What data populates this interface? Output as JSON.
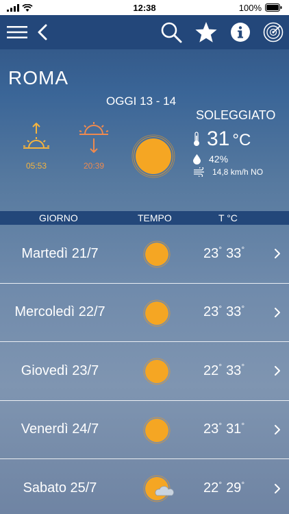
{
  "status_bar": {
    "time": "12:38",
    "battery": "100%"
  },
  "nav": {
    "menu_icon": "hamburger-icon",
    "back_icon": "chevron-left-icon",
    "search_icon": "search-icon",
    "favorite_icon": "star-icon",
    "info_icon": "info-icon",
    "radar_icon": "radar-icon"
  },
  "hero": {
    "city": "ROMA",
    "today": "OGGI 13 - 14",
    "condition": "SOLEGGIATO",
    "sunrise": "05:53",
    "sunset": "20:39",
    "temperature": "31",
    "temperature_unit": "°C",
    "humidity": "42%",
    "wind": "14,8 km/h NO"
  },
  "columns": {
    "day": "GIORNO",
    "weather": "TEMPO",
    "temp": "T °C"
  },
  "forecast": [
    {
      "day": "Martedì 21/7",
      "icon": "sun-icon",
      "min": "23",
      "max": "33"
    },
    {
      "day": "Mercoledì 22/7",
      "icon": "sun-icon",
      "min": "23",
      "max": "33"
    },
    {
      "day": "Giovedì 23/7",
      "icon": "sun-icon",
      "min": "22",
      "max": "33"
    },
    {
      "day": "Venerdì 24/7",
      "icon": "sun-icon",
      "min": "23",
      "max": "31"
    },
    {
      "day": "Sabato 25/7",
      "icon": "sun-cloud-icon",
      "min": "22",
      "max": "29"
    }
  ],
  "degree_symbol": "°",
  "colors": {
    "navbar": "#23477a",
    "sun": "#f5a623",
    "sunset": "#ee8a4f"
  }
}
